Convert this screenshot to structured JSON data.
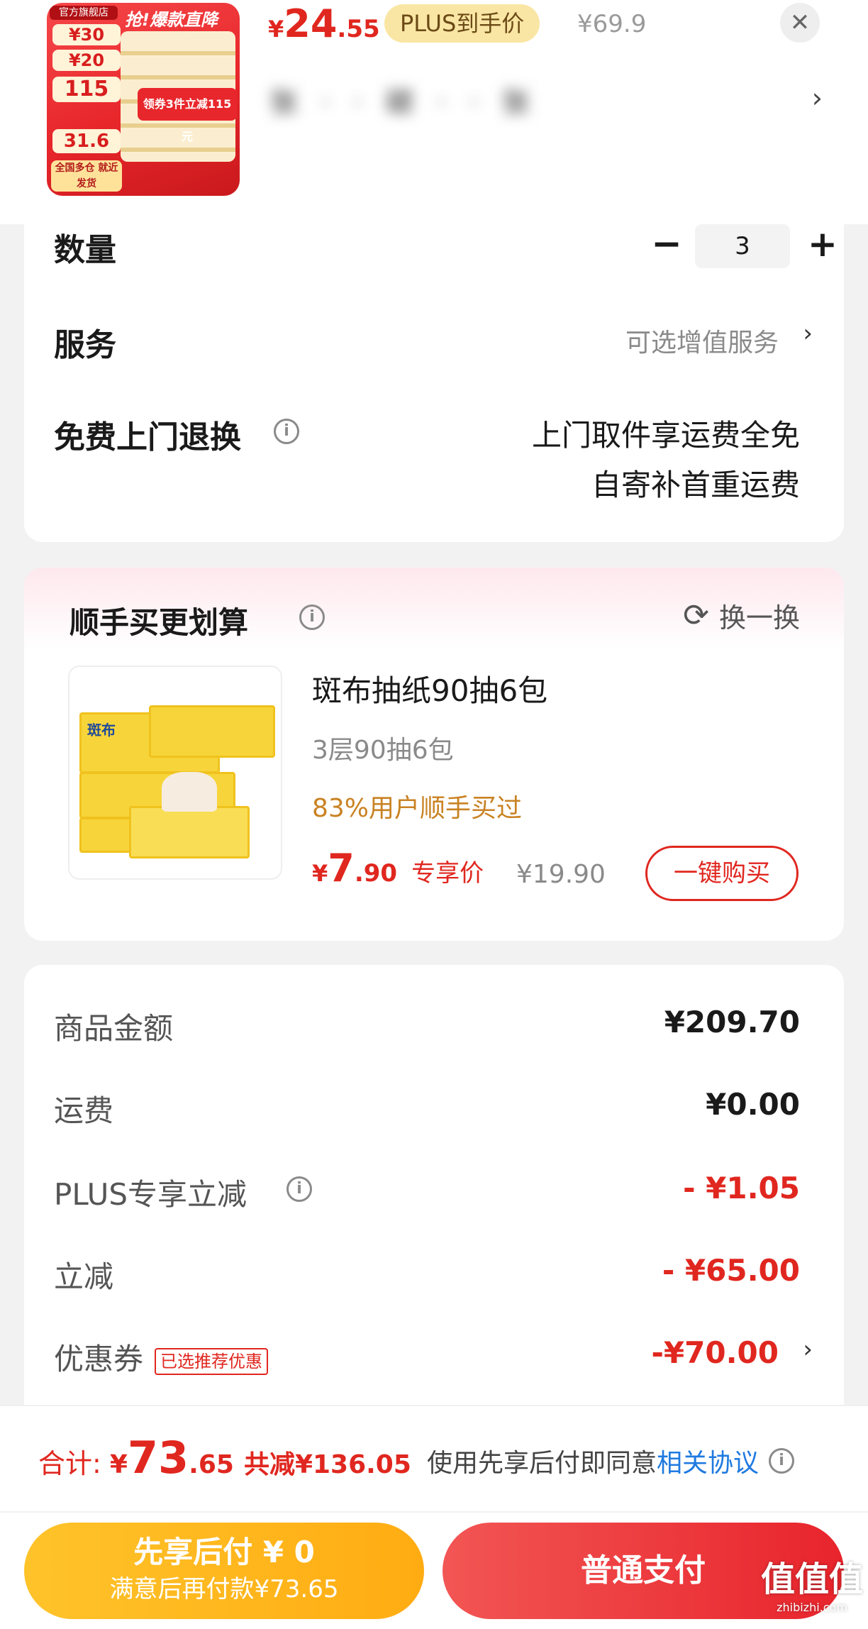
{
  "header": {
    "price_yen": "¥",
    "price_int": "24",
    "price_dec": ".55",
    "plus_tag": "PLUS到手价",
    "orig_price": "¥69.9",
    "close_glyph": "✕",
    "selection_text": "张 · · 碳 · · 张",
    "chevron": "›",
    "thumb": {
      "shop": "官方旗舰店",
      "headline": "抢!爆款直降",
      "promo": "领券3件立减115元",
      "badge_30": "¥30",
      "badge_20": "¥20",
      "badge_115": "115",
      "badge_31": "31.6",
      "bottom": "全国多仓 就近发货"
    }
  },
  "options": {
    "quantity_label": "数量",
    "quantity_value": "3",
    "minus_glyph": "−",
    "plus_glyph": "+",
    "service_label": "服务",
    "service_value": "可选增值服务",
    "return_label": "免费上门退换",
    "return_line1": "上门取件享运费全免",
    "return_line2": "自寄补首重运费",
    "info_glyph": "i",
    "chevron": "›"
  },
  "reco": {
    "title": "顺手买更划算",
    "refresh_label": "换一换",
    "refresh_glyph": "⟳",
    "product_name": "斑布抽纸90抽6包",
    "spec": "3层90抽6包",
    "social_proof": "83%用户顺手买过",
    "price_yen": "¥",
    "price_int": "7",
    "price_dec": ".90",
    "price_tag": "专享价",
    "orig_price": "¥19.90",
    "buy_button": "一键购买",
    "box_brand": "斑布"
  },
  "summary": {
    "goods_label": "商品金额",
    "goods_value": "¥209.70",
    "shipping_label": "运费",
    "shipping_value": "¥0.00",
    "plus_label": "PLUS专享立减",
    "plus_value": "- ¥1.05",
    "discount_label": "立减",
    "discount_value": "- ¥65.00",
    "coupon_label": "优惠券",
    "coupon_tag": "已选推荐优惠",
    "coupon_value": "-¥70.00"
  },
  "total": {
    "label": "合计:",
    "yen": "¥",
    "int": "73",
    "dec": ".65",
    "saved": "共减¥136.05",
    "agreement_prefix": "使用先享后付即同意",
    "agreement_link": "相关协议"
  },
  "actions": {
    "paylater_title": "先享后付 ¥ 0",
    "paylater_sub": "满意后再付款¥73.65",
    "normal_pay": "普通支付"
  },
  "watermark": {
    "main": "值值值",
    "sub": "zhibizhi.com"
  },
  "colors": {
    "accent_red": "#e0271f",
    "plus_gold": "#fae6a4",
    "paylater_orange": "#ffb01c",
    "link_blue": "#1f7ae0"
  }
}
